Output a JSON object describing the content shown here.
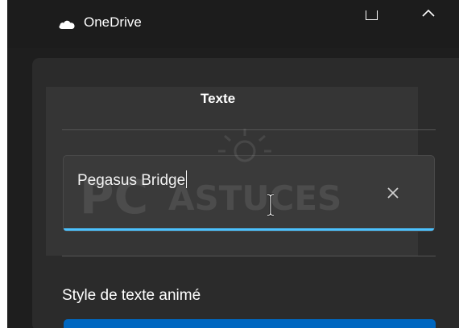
{
  "window": {
    "app_name": "OneDrive",
    "icons": {
      "app": "cloud-icon",
      "maximize": "maximize-icon",
      "collapse": "chevron-up-icon"
    }
  },
  "dialog": {
    "title": "Texte",
    "text_input": {
      "value": "Pegasus Bridge",
      "clear_icon": "close-icon"
    },
    "watermark": "PCASTUCES"
  },
  "animated_style": {
    "label": "Style de texte animé"
  },
  "colors": {
    "accent": "#4cc2ff",
    "selected_style": "#0067c0",
    "background": "#1e1e1e",
    "panel": "#2b2b2b"
  }
}
